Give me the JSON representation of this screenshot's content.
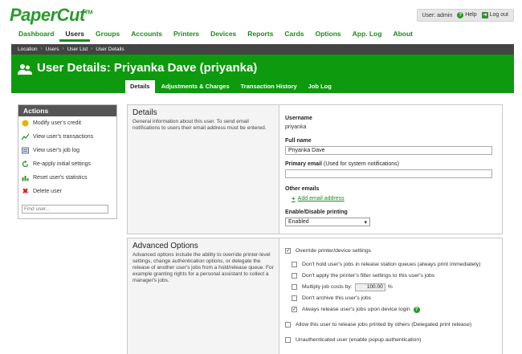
{
  "header": {
    "logo": "PaperCut",
    "logo_tm": "TM",
    "user_label": "User: admin",
    "help_label": "Help",
    "logout_label": "Log out"
  },
  "nav": [
    "Dashboard",
    "Users",
    "Groups",
    "Accounts",
    "Printers",
    "Devices",
    "Reports",
    "Cards",
    "Options",
    "App. Log",
    "About"
  ],
  "nav_active": "Users",
  "breadcrumb": [
    "Location",
    "Users",
    "User List",
    "User Details"
  ],
  "page_title": "User Details: Priyanka Dave (priyanka)",
  "tabs": [
    "Details",
    "Adjustments & Charges",
    "Transaction History",
    "Job Log"
  ],
  "actions": {
    "title": "Actions",
    "items": [
      {
        "label": "Modify user's credit",
        "icon": "coin-icon"
      },
      {
        "label": "View user's transactions",
        "icon": "chart-icon"
      },
      {
        "label": "View user's job log",
        "icon": "log-icon"
      },
      {
        "label": "Re-apply initial settings",
        "icon": "reapply-icon"
      },
      {
        "label": "Reset user's statistics",
        "icon": "reset-icon"
      },
      {
        "label": "Delete user",
        "icon": "delete-icon"
      }
    ],
    "find_placeholder": "Find user..."
  },
  "details": {
    "title": "Details",
    "description": "General information about this user. To send email notifications to users their email address must be entered.",
    "username_label": "Username",
    "username_value": "priyanka",
    "fullname_label": "Full name",
    "fullname_value": "Priyanka Dave",
    "email_label": "Primary email",
    "email_hint": "(Used for system notifications)",
    "email_value": "",
    "other_emails_label": "Other emails",
    "add_email_label": "Add email address",
    "printing_label": "Enable/Disable printing",
    "printing_value": "Enabled"
  },
  "advanced": {
    "title": "Advanced Options",
    "description": "Advanced options include the ability to override printer-level settings, change authentication options, or delegate the release of another user's jobs from a hold/release queue. For example granting rights for a personal assistant to collect a manager's jobs.",
    "override_label": "Override printer/device settings",
    "override_checked": true,
    "options": [
      {
        "label": "Don't hold user's jobs in release station queues (always print immediately)",
        "checked": false
      },
      {
        "label": "Don't apply the printer's filter settings to this user's jobs",
        "checked": false
      },
      {
        "label": "Multiply job costs by:",
        "checked": false
      },
      {
        "label": "Don't archive this user's jobs",
        "checked": false
      },
      {
        "label": "Always release user's jobs upon device login",
        "checked": true
      }
    ],
    "multiplier_value": "100.00",
    "multiplier_unit": "%",
    "delegate_label": "Allow this user to release jobs printed by others (Delegated print release)",
    "delegate_checked": false,
    "unauth_label": "Unauthenticated user (enable popup authentication)",
    "unauth_checked": false
  },
  "colors": {
    "brand_green": "#0e9a0e",
    "nav_green": "#1f8a1f",
    "breadcrumb_bg": "#444444"
  }
}
